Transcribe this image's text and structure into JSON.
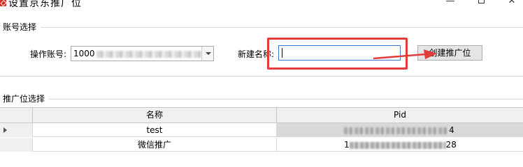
{
  "window": {
    "title": "设置京东推广位",
    "minimize": "—",
    "close": "✕"
  },
  "account_group": {
    "title": "账号选择",
    "account_label": "操作账号:",
    "account_value_prefix": "1000",
    "new_name_label": "新建名称:",
    "new_name_value": "",
    "create_button": "创建推广位"
  },
  "adzone_group": {
    "title": "推广位选择",
    "columns": [
      "名称",
      "Pid"
    ],
    "rows": [
      {
        "name": "test",
        "pid_prefix": "",
        "pid_suffix": "4",
        "selected": true
      },
      {
        "name": "微信推广",
        "pid_prefix": "1",
        "pid_suffix": "28",
        "selected": false
      }
    ]
  },
  "colors": {
    "highlight": "#e53b3b",
    "selected_cell": "#d9d9d9"
  },
  "icons": [
    "jd-app-icon",
    "minimize-icon",
    "maximize-icon",
    "close-icon",
    "dropdown-arrow-icon",
    "row-pointer-icon",
    "annotation-arrow-icon"
  ]
}
